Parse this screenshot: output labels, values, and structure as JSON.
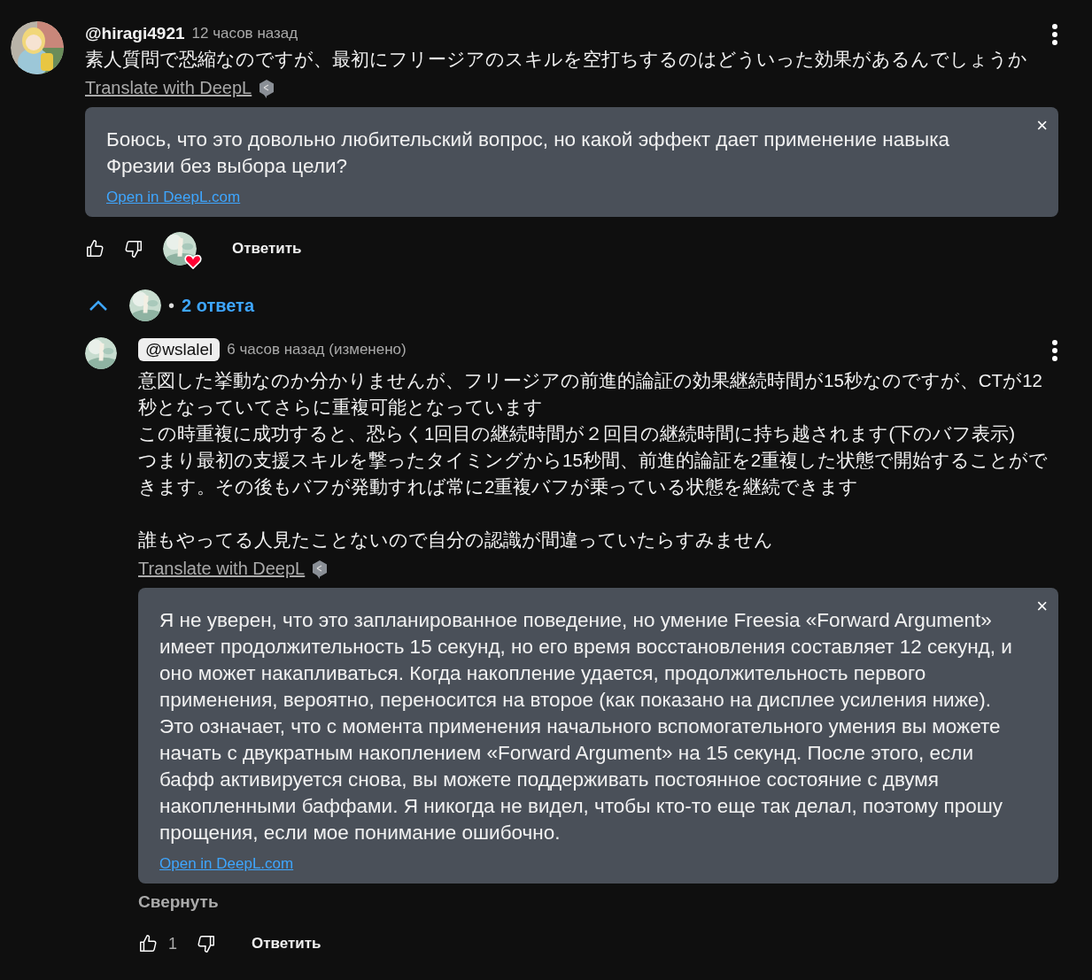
{
  "comment": {
    "author": "@hiragi4921",
    "time": "12 часов назад",
    "text": "素人質問で恐縮なのですが、最初にフリージアのスキルを空打ちするのはどういった効果があるんでしょうか",
    "translate_link": "Translate with DeepL",
    "translation": {
      "text": "Боюсь, что это довольно любительский вопрос, но какой эффект дает применение навыка Фрезии без выбора цели?",
      "link": "Open in DeepL.com",
      "close": "×"
    },
    "reply_button": "Ответить",
    "creator_heart": true,
    "replies_toggle": {
      "separator": "•",
      "label": "2 ответа",
      "expanded": true
    }
  },
  "replies": [
    {
      "author": "@wslalel",
      "author_highlighted": true,
      "time": "6 часов назад (изменено)",
      "paragraphs": [
        {
          "kind": "line",
          "text": "意図した挙動なのか分かりませんが、フリージアの前進的論証の効果継続時間が15秒なのですが、CTが12秒となっていてさらに重複可能となっています"
        },
        {
          "kind": "line",
          "text": "この時重複に成功すると、恐らく1回目の継続時間が２回目の継続時間に持ち越されます(下のバフ表示)"
        },
        {
          "kind": "line",
          "text": "つまり最初の支援スキルを撃ったタイミングから15秒間、前進的論証を2重複した状態で開始することができます。その後もバフが発動すれば常に2重複バフが乗っている状態を継続できます"
        },
        {
          "kind": "spaced",
          "text": "誰もやってる人見たことないので自分の認識が間違っていたらすみません"
        }
      ],
      "translate_link": "Translate with DeepL",
      "translation": {
        "text": "Я не уверен, что это запланированное поведение, но умение Freesia «Forward Argument» имеет продолжительность 15 секунд, но его время восстановления составляет 12 секунд, и оно может накапливаться. Когда накопление удается, продолжительность первого применения, вероятно, переносится на второе (как показано на дисплее усиления ниже). Это означает, что с момента применения начального вспомогательного умения вы можете начать с двукратным накоплением «Forward Argument» на 15 секунд. После этого, если бафф активируется снова, вы можете поддерживать постоянное состояние с двумя накопленными баффами. Я никогда не видел, чтобы кто-то еще так делал, поэтому прошу прощения, если мое понимание ошибочно.",
        "link": "Open in DeepL.com",
        "close": "×"
      },
      "collapse": "Свернуть",
      "likes": "1",
      "reply_button": "Ответить"
    }
  ]
}
